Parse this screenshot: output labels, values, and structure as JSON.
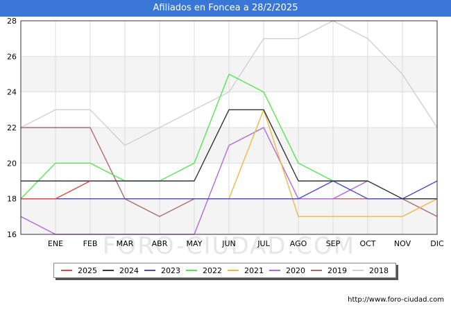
{
  "header": {
    "title": "Afiliados en Foncea a 28/2/2025"
  },
  "watermark": "FORO-CIUDAD.COM",
  "source": "http://www.foro-ciudad.com",
  "chart_data": {
    "type": "line",
    "title": "Afiliados en Foncea a 28/2/2025",
    "xlabel": "",
    "ylabel": "",
    "categories": [
      "ENE",
      "FEB",
      "MAR",
      "ABR",
      "MAY",
      "JUN",
      "JUL",
      "AGO",
      "SEP",
      "OCT",
      "NOV",
      "DIC"
    ],
    "ylim": [
      16,
      28
    ],
    "yticks": [
      16,
      18,
      20,
      22,
      24,
      26,
      28
    ],
    "grid": true,
    "legend_position": "bottom",
    "series": [
      {
        "name": "2018",
        "color": "#d0d0d0",
        "values": [
          22,
          23,
          23,
          21,
          22,
          23,
          24,
          27,
          27,
          28,
          27,
          25,
          22
        ]
      },
      {
        "name": "2019",
        "color": "#b06a6a",
        "values": [
          22,
          22,
          22,
          18,
          17,
          18,
          18,
          18,
          18,
          18,
          18,
          18,
          17
        ]
      },
      {
        "name": "2020",
        "color": "#b366e0",
        "values": [
          17,
          16,
          16,
          16,
          16,
          16,
          21,
          22,
          18,
          18,
          19,
          null,
          null
        ]
      },
      {
        "name": "2021",
        "color": "#f0b840",
        "values": [
          18,
          18,
          18,
          18,
          18,
          18,
          18,
          23,
          17,
          17,
          17,
          17,
          18
        ]
      },
      {
        "name": "2022",
        "color": "#55e655",
        "values": [
          18,
          20,
          20,
          19,
          19,
          20,
          25,
          24,
          20,
          19,
          19,
          null,
          null
        ]
      },
      {
        "name": "2023",
        "color": "#4a4acc",
        "values": [
          18,
          18,
          18,
          18,
          18,
          18,
          18,
          18,
          18,
          19,
          18,
          18,
          19
        ]
      },
      {
        "name": "2024",
        "color": "#333333",
        "values": [
          19,
          19,
          19,
          19,
          19,
          19,
          23,
          23,
          19,
          19,
          19,
          18,
          18
        ]
      },
      {
        "name": "2025",
        "color": "#e04848",
        "values": [
          18,
          18,
          19,
          null,
          null,
          null,
          null,
          null,
          null,
          null,
          null,
          null,
          null
        ]
      }
    ],
    "legend_order": [
      "2025",
      "2024",
      "2023",
      "2022",
      "2021",
      "2020",
      "2019",
      "2018"
    ]
  }
}
